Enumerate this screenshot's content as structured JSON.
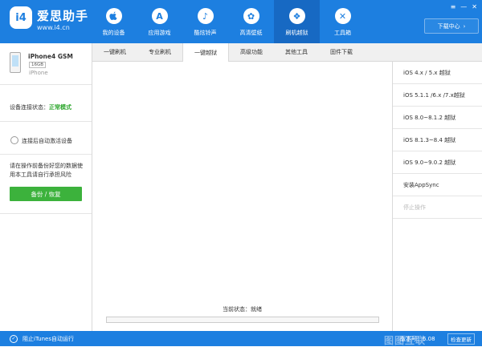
{
  "header": {
    "logo": "i4",
    "brand_name": "爱思助手",
    "brand_url": "www.i4.cn",
    "nav": [
      {
        "label": "我的设备",
        "icon": "apple-icon",
        "glyph": ""
      },
      {
        "label": "应用游戏",
        "icon": "app-store-icon",
        "glyph": "A"
      },
      {
        "label": "酷炫铃声",
        "icon": "bell-icon",
        "glyph": "♪"
      },
      {
        "label": "高清壁纸",
        "icon": "flower-icon",
        "glyph": "✿"
      },
      {
        "label": "刷机越狱",
        "icon": "box-icon",
        "glyph": "❖"
      },
      {
        "label": "工具箱",
        "icon": "tools-icon",
        "glyph": "✕"
      }
    ],
    "download_center": "下载中心",
    "window_controls": {
      "menu": "≡",
      "minimize": "—",
      "close": "✕"
    }
  },
  "device": {
    "name": "iPhone4 GSM",
    "capacity": "16GB",
    "os": "iPhone"
  },
  "left_panel": {
    "conn_status_prefix": "设备连接状态：",
    "conn_status_value": "正常模式",
    "auto_activate_label": "连接后自动激活设备",
    "warning_text": "请在操作前备份好您的数据使用本工具请自行承担风险",
    "backup_button": "备份 / 恢复"
  },
  "tabs": [
    {
      "label": "一键刷机"
    },
    {
      "label": "专业刷机"
    },
    {
      "label": "一键越狱"
    },
    {
      "label": "高级功能"
    },
    {
      "label": "其他工具"
    },
    {
      "label": "固件下载"
    }
  ],
  "active_tab": 2,
  "content": {
    "status_text": "当前状态：就绪"
  },
  "right_menu": [
    {
      "label": "iOS 4.x / 5.x 越狱",
      "disabled": false
    },
    {
      "label": "iOS 5.1.1 /6.x /7.x越狱",
      "disabled": false
    },
    {
      "label": "iOS 8.0~8.1.2 越狱",
      "disabled": false
    },
    {
      "label": "iOS 8.1.3~8.4 越狱",
      "disabled": false
    },
    {
      "label": "iOS 9.0~9.0.2 越狱",
      "disabled": false
    },
    {
      "label": "安装AppSync",
      "disabled": false
    },
    {
      "label": "停止操作",
      "disabled": true
    }
  ],
  "footer": {
    "itunes_label": "阻止iTunes自动运行",
    "watermark": "图图互联",
    "version": "版本号：6.08",
    "update_button": "检查更新"
  },
  "colors": {
    "brand_blue": "#1d7fe0",
    "active_nav": "#1769c3",
    "success_green": "#2aa52a",
    "button_green": "#3cb23c"
  }
}
